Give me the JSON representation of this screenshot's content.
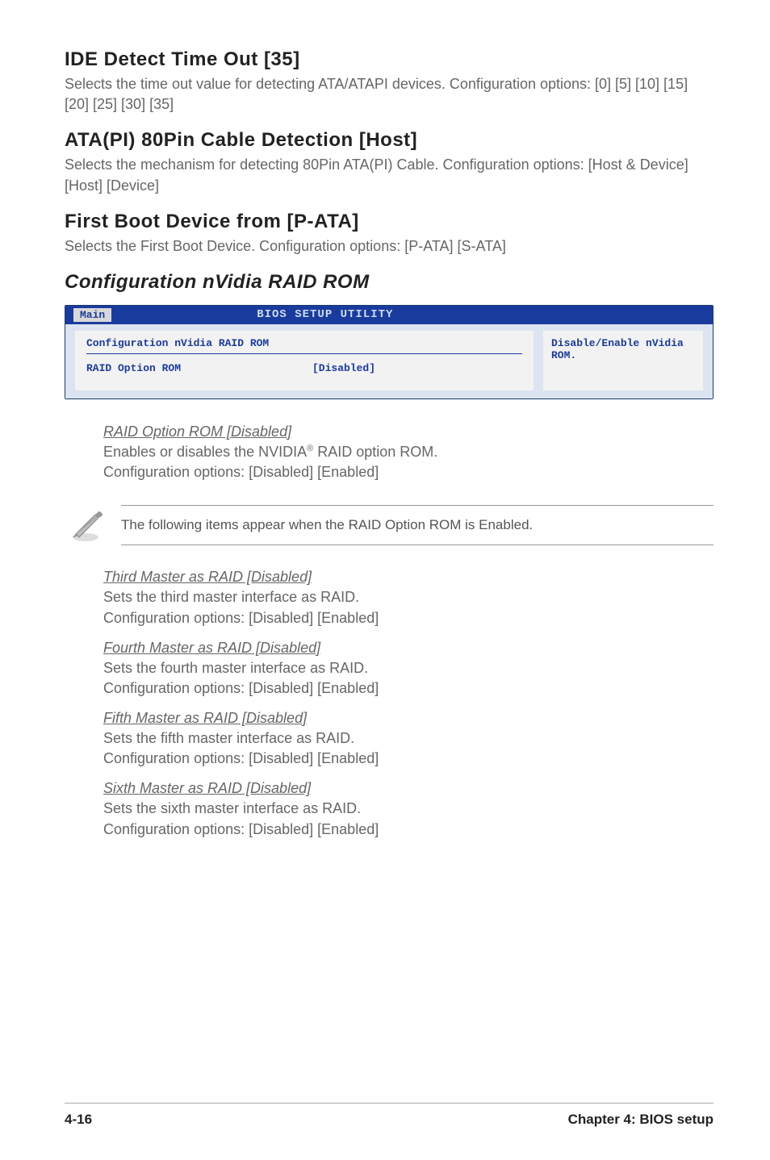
{
  "sections": {
    "ide": {
      "title": "IDE Detect Time Out [35]",
      "desc": "Selects the time out value for detecting ATA/ATAPI devices. Configuration options: [0] [5] [10] [15] [20] [25] [30] [35]"
    },
    "ata": {
      "title": "ATA(PI) 80Pin Cable Detection [Host]",
      "desc": "Selects the mechanism for detecting 80Pin ATA(PI) Cable. Configuration options: [Host & Device] [Host] [Device]"
    },
    "firstboot": {
      "title": "First Boot Device from [P-ATA]",
      "desc": "Selects the First Boot Device. Configuration options: [P-ATA] [S-ATA]"
    },
    "nvraid_heading": "Configuration nVidia RAID ROM"
  },
  "bios": {
    "tab": "Main",
    "title": "BIOS SETUP UTILITY",
    "config_line": "Configuration nVidia RAID ROM",
    "option_label": "RAID Option ROM",
    "option_value": "[Disabled]",
    "help": "Disable/Enable nVidia ROM."
  },
  "raid_option": {
    "heading": "RAID Option ROM [Disabled]",
    "line1_pre": "Enables or disables the NVIDIA",
    "line1_post": " RAID option ROM.",
    "line2": "Configuration options: [Disabled] [Enabled]"
  },
  "note": "The following items appear when the RAID Option ROM is Enabled.",
  "masters": [
    {
      "heading": "Third Master as RAID [Disabled]",
      "line1": "Sets the third master interface as RAID.",
      "line2": "Configuration options: [Disabled] [Enabled]"
    },
    {
      "heading": "Fourth Master as RAID [Disabled]",
      "line1": "Sets the fourth master interface as RAID.",
      "line2": "Configuration options: [Disabled] [Enabled]"
    },
    {
      "heading": "Fifth Master as RAID [Disabled]",
      "line1": "Sets the fifth master interface as RAID.",
      "line2": "Configuration options: [Disabled] [Enabled]"
    },
    {
      "heading": "Sixth Master as RAID [Disabled]",
      "line1": "Sets the sixth master interface as RAID.",
      "line2": "Configuration options: [Disabled] [Enabled]"
    }
  ],
  "footer": {
    "page": "4-16",
    "chapter": "Chapter 4: BIOS setup"
  }
}
